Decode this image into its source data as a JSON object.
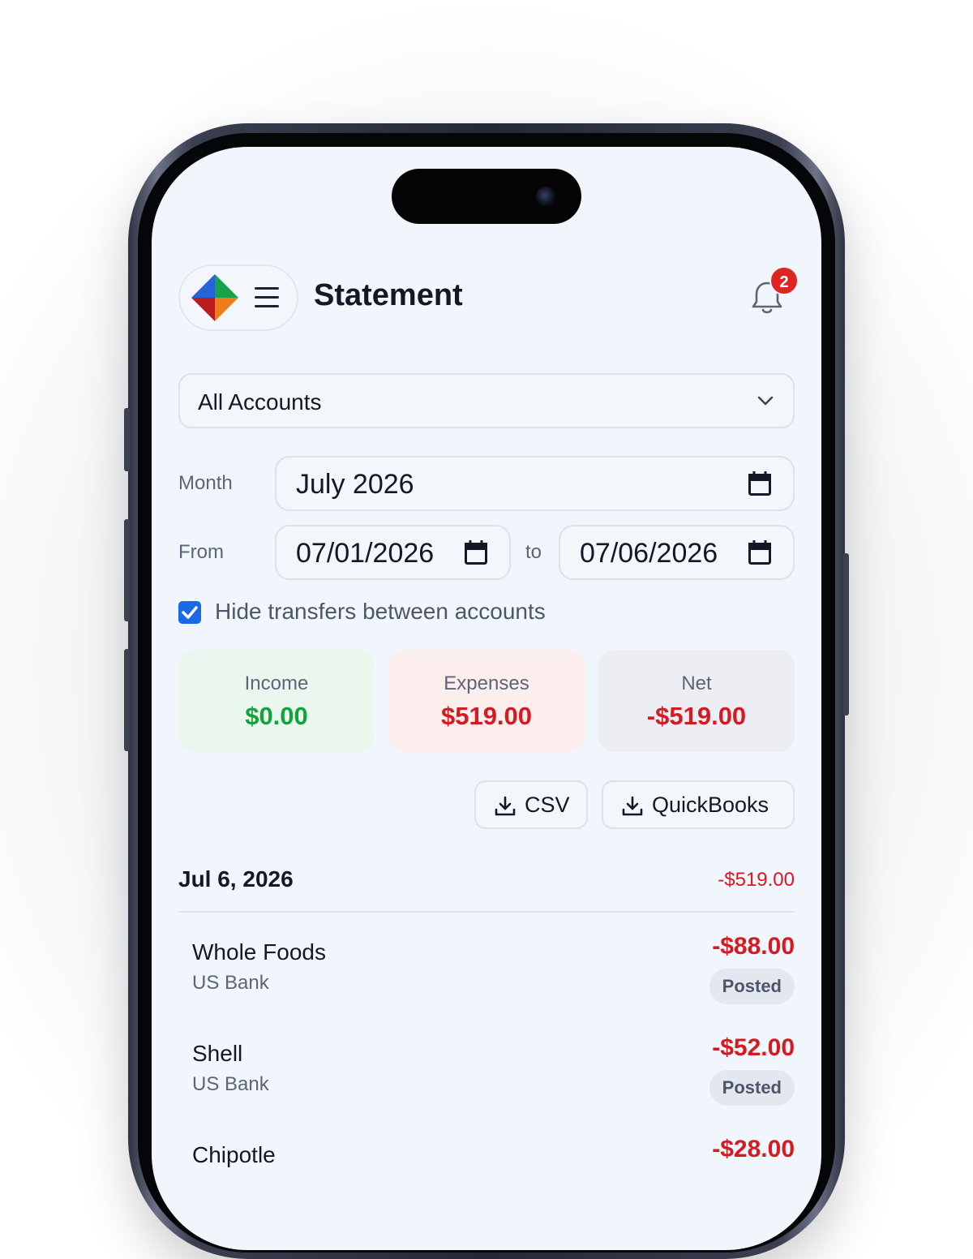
{
  "header": {
    "title": "Statement",
    "notification_count": "2"
  },
  "accounts_select": {
    "value": "All Accounts"
  },
  "filters": {
    "month_label": "Month",
    "month_value": "July 2026",
    "from_label": "From",
    "from_value": "07/01/2026",
    "to_label": "to",
    "to_value": "07/06/2026"
  },
  "hide_transfers": {
    "label": "Hide transfers between accounts",
    "checked": true
  },
  "summary": {
    "income": {
      "label": "Income",
      "value": "$0.00"
    },
    "expenses": {
      "label": "Expenses",
      "value": "$519.00"
    },
    "net": {
      "label": "Net",
      "value": "-$519.00"
    }
  },
  "export": {
    "csv_label": "CSV",
    "quickbooks_label": "QuickBooks"
  },
  "day_group": {
    "date": "Jul 6, 2026",
    "total": "-$519.00",
    "transactions": [
      {
        "name": "Whole Foods",
        "account": "US Bank",
        "amount": "-$88.00",
        "status": "Posted"
      },
      {
        "name": "Shell",
        "account": "US Bank",
        "amount": "-$52.00",
        "status": "Posted"
      },
      {
        "name": "Chipotle",
        "account": "",
        "amount": "-$28.00",
        "status": ""
      }
    ]
  },
  "colors": {
    "accent": "#1a6ae6",
    "negative": "#d61a22",
    "positive": "#12a33a",
    "income_card": "#eaf7ef",
    "expenses_card": "#fdeeee",
    "net_card": "#eceef3"
  },
  "icons": [
    "logo-icon",
    "menu-icon",
    "bell-icon",
    "chevron-down-icon",
    "calendar-icon",
    "checkbox-check-icon",
    "download-icon"
  ]
}
